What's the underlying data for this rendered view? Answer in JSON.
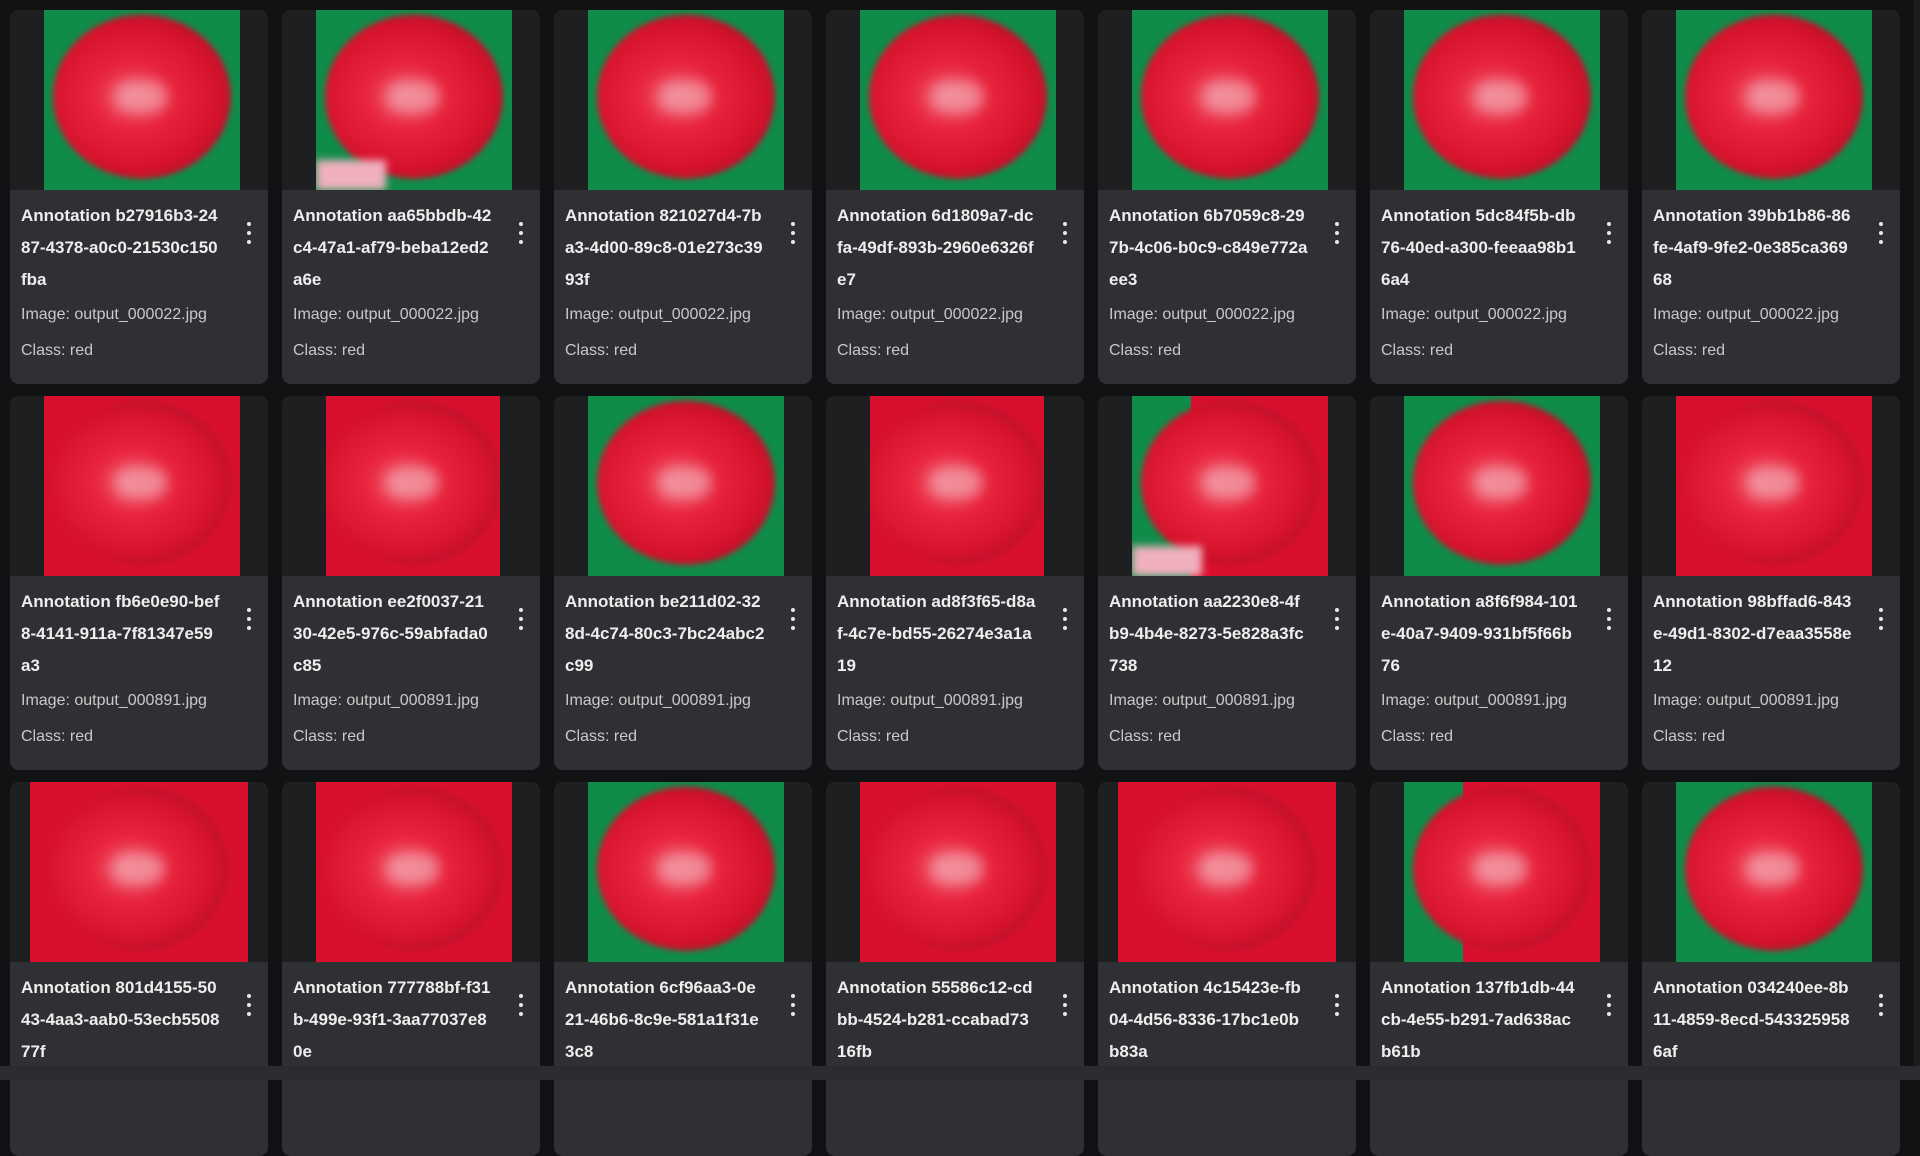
{
  "gallery": {
    "cards": [
      {
        "title": "Annotation b27916b3-2487-4378-a0c0-21530c150fba",
        "image": "Image: output_000022.jpg",
        "cls": "Class: red",
        "variant": "green"
      },
      {
        "title": "Annotation aa65bbdb-42c4-47a1-af79-beba12ed2a6e",
        "image": "Image: output_000022.jpg",
        "cls": "Class: red",
        "variant": "green-pink"
      },
      {
        "title": "Annotation 821027d4-7ba3-4d00-89c8-01e273c3993f",
        "image": "Image: output_000022.jpg",
        "cls": "Class: red",
        "variant": "green"
      },
      {
        "title": "Annotation 6d1809a7-dcfa-49df-893b-2960e6326fe7",
        "image": "Image: output_000022.jpg",
        "cls": "Class: red",
        "variant": "green"
      },
      {
        "title": "Annotation 6b7059c8-297b-4c06-b0c9-c849e772aee3",
        "image": "Image: output_000022.jpg",
        "cls": "Class: red",
        "variant": "green"
      },
      {
        "title": "Annotation 5dc84f5b-db76-40ed-a300-feeaa98b16a4",
        "image": "Image: output_000022.jpg",
        "cls": "Class: red",
        "variant": "green"
      },
      {
        "title": "Annotation 39bb1b86-86fe-4af9-9fe2-0e385ca36968",
        "image": "Image: output_000022.jpg",
        "cls": "Class: red",
        "variant": "green"
      },
      {
        "title": "Annotation fb6e0e90-bef8-4141-911a-7f81347e59a3",
        "image": "Image: output_000891.jpg",
        "cls": "Class: red",
        "variant": "red"
      },
      {
        "title": "Annotation ee2f0037-2130-42e5-976c-59abfada0c85",
        "image": "Image: output_000891.jpg",
        "cls": "Class: red",
        "variant": "red-narrow"
      },
      {
        "title": "Annotation be211d02-328d-4c74-80c3-7bc24abc2c99",
        "image": "Image: output_000891.jpg",
        "cls": "Class: red",
        "variant": "green"
      },
      {
        "title": "Annotation ad8f3f65-d8af-4c7e-bd55-26274e3a1a19",
        "image": "Image: output_000891.jpg",
        "cls": "Class: red",
        "variant": "red-narrow"
      },
      {
        "title": "Annotation aa2230e8-4fb9-4b4e-8273-5e828a3fc738",
        "image": "Image: output_000891.jpg",
        "cls": "Class: red",
        "variant": "mixed-pink"
      },
      {
        "title": "Annotation a8f6f984-101e-40a7-9409-931bf5f66b76",
        "image": "Image: output_000891.jpg",
        "cls": "Class: red",
        "variant": "green"
      },
      {
        "title": "Annotation 98bffad6-843e-49d1-8302-d7eaa3558e12",
        "image": "Image: output_000891.jpg",
        "cls": "Class: red",
        "variant": "red"
      },
      {
        "title": "Annotation 801d4155-5043-4aa3-aab0-53ecb550877f",
        "image": "",
        "cls": "",
        "variant": "red-wide"
      },
      {
        "title": "Annotation 777788bf-f31b-499e-93f1-3aa77037e80e",
        "image": "",
        "cls": "",
        "variant": "red"
      },
      {
        "title": "Annotation 6cf96aa3-0e21-46b6-8c9e-581a1f31e3c8",
        "image": "",
        "cls": "",
        "variant": "green"
      },
      {
        "title": "Annotation 55586c12-cdbb-4524-b281-ccabad7316fb",
        "image": "",
        "cls": "",
        "variant": "red"
      },
      {
        "title": "Annotation 4c15423e-fb04-4d56-8336-17bc1e0bb83a",
        "image": "",
        "cls": "",
        "variant": "red-wide"
      },
      {
        "title": "Annotation 137fb1db-44cb-4e55-b291-7ad638acb61b",
        "image": "",
        "cls": "",
        "variant": "mixed"
      },
      {
        "title": "Annotation 034240ee-8b11-4859-8ecd-5433259586af",
        "image": "",
        "cls": "",
        "variant": "green"
      }
    ]
  },
  "colors": {
    "page_bg": "#111214",
    "card_bg": "#2f3033",
    "object_red": "#d5122c",
    "background_green": "#0f8c4a"
  }
}
